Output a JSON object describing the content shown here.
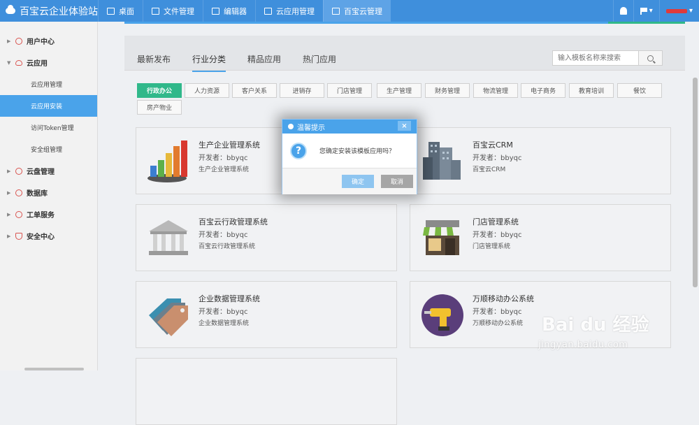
{
  "app": {
    "title": "百宝云企业体验站"
  },
  "nav": {
    "tabs": [
      {
        "label": "桌面",
        "icon": "monitor-icon"
      },
      {
        "label": "文件管理",
        "icon": "folder-icon"
      },
      {
        "label": "编辑器",
        "icon": "edit-icon"
      },
      {
        "label": "云应用管理",
        "icon": "cube-icon"
      },
      {
        "label": "百宝云管理",
        "icon": "user-gear-icon",
        "active": true
      }
    ]
  },
  "sidebar": {
    "items": [
      {
        "label": "用户中心",
        "icon": "user-circle-icon"
      },
      {
        "label": "云应用",
        "icon": "cloud-icon",
        "expanded": true
      },
      {
        "label": "云应用管理"
      },
      {
        "label": "云应用安装",
        "active": true
      },
      {
        "label": "访问Token管理"
      },
      {
        "label": "安全组管理"
      },
      {
        "label": "云盘管理",
        "icon": "cloud-disk-icon"
      },
      {
        "label": "数据库",
        "icon": "database-icon"
      },
      {
        "label": "工单服务",
        "icon": "ticket-icon"
      },
      {
        "label": "安全中心",
        "icon": "shield-icon"
      }
    ]
  },
  "main": {
    "tabs": [
      "最新发布",
      "行业分类",
      "精品应用",
      "热门应用"
    ],
    "active_tab": "行业分类",
    "search": {
      "placeholder": "输入模板名称来搜索"
    },
    "filters": [
      "行政办公",
      "人力资源",
      "客户关系",
      "进销存",
      "门店管理",
      "生产管理",
      "财务管理",
      "物流管理",
      "电子商务",
      "教育培训",
      "餐饮",
      "房产物业"
    ],
    "active_filter": "行政办公",
    "cards": [
      {
        "title": "生产企业管理系统",
        "dev": "开发者：bbyqc",
        "desc": "生产企业管理系统",
        "icon": "bar-chart-icon"
      },
      {
        "title": "百宝云CRM",
        "dev": "开发者：bbyqc",
        "desc": "百宝云CRM",
        "icon": "buildings-icon"
      },
      {
        "title": "百宝云行政管理系统",
        "dev": "开发者：bbyqc",
        "desc": "百宝云行政管理系统",
        "icon": "government-building-icon"
      },
      {
        "title": "门店管理系统",
        "dev": "开发者：bbyqc",
        "desc": "门店管理系统",
        "icon": "storefront-icon"
      },
      {
        "title": "企业数据管理系统",
        "dev": "开发者：bbyqc",
        "desc": "企业数据管理系统",
        "icon": "tags-icon"
      },
      {
        "title": "万顺移动办公系统",
        "dev": "开发者：bbyqc",
        "desc": "万顺移动办公系统",
        "icon": "drill-icon"
      }
    ]
  },
  "modal": {
    "title": "温馨提示",
    "close": "×",
    "message": "您确定安装该模板应用吗？",
    "ok": "确定",
    "cancel": "取消"
  },
  "watermark": {
    "logo": "Bai du 经验",
    "url": "jingyan.baidu.com"
  },
  "colors": {
    "primary": "#3f8fdc",
    "accent": "#4aa3ea",
    "green": "#30b88a"
  }
}
